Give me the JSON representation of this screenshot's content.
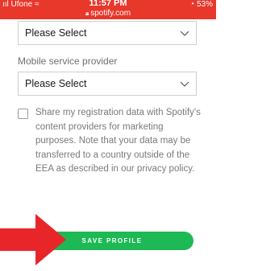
{
  "status_bar": {
    "carrier": "ııl Ufone ≈",
    "time": "11:57 PM",
    "battery": "◔ 53%",
    "url": "spotify.com",
    "lock_icon": "lock-icon"
  },
  "form": {
    "first_select": {
      "value": "Please Select"
    },
    "mobile_provider": {
      "label": "Mobile service provider",
      "value": "Please Select"
    },
    "consent": {
      "text": "Share my registration data with Spotify's content providers for marketing purposes. Note that your data may be transferred to a country outside of the EEA as described in our privacy policy.",
      "checked": false
    },
    "save_button": "SAVE PROFILE"
  },
  "colors": {
    "status_bar": "#e8372b",
    "save_button": "#1db954",
    "arrow": "#e8262a"
  }
}
